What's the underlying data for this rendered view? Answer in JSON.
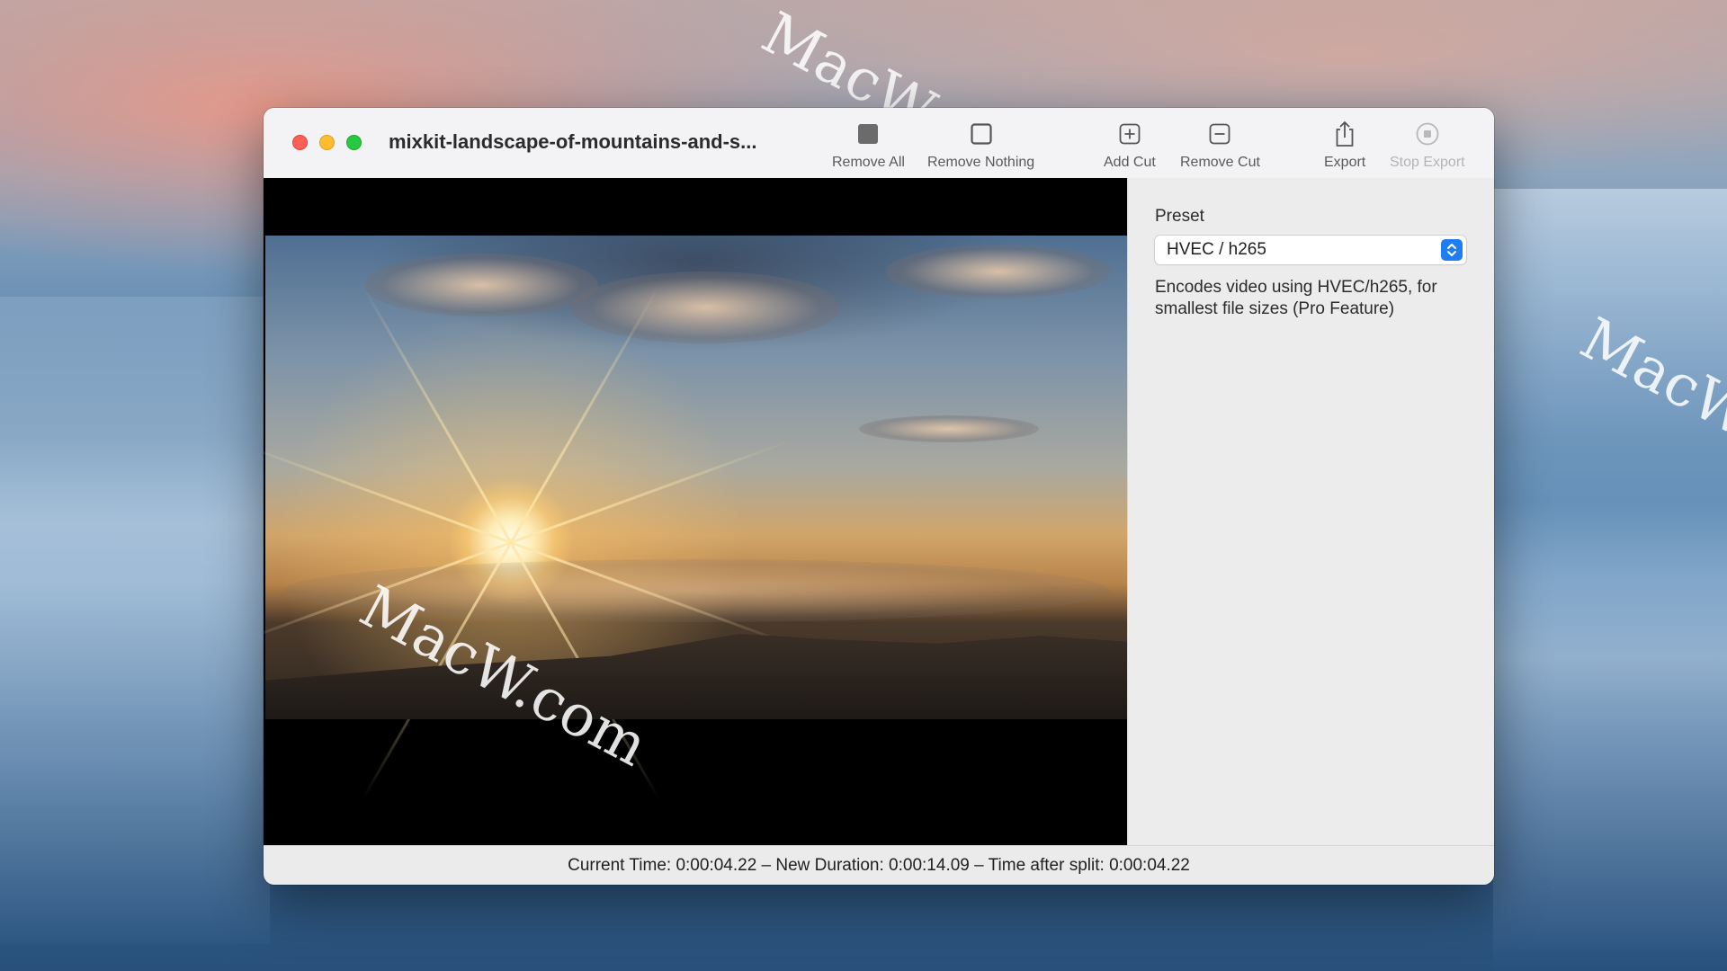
{
  "window": {
    "title": "mixkit-landscape-of-mountains-and-s..."
  },
  "toolbar": {
    "remove_all": "Remove All",
    "remove_nothing": "Remove Nothing",
    "add_cut": "Add Cut",
    "remove_cut": "Remove Cut",
    "export": "Export",
    "stop_export": "Stop Export"
  },
  "sidebar": {
    "preset_label": "Preset",
    "preset_value": "HVEC / h265",
    "preset_description": "Encodes video using HVEC/h265, for smallest file sizes (Pro Feature)"
  },
  "status": {
    "text": "Current Time: 0:00:04.22 – New Duration: 0:00:14.09 – Time after split: 0:00:04.22"
  },
  "watermark": {
    "text": "MacW.com"
  },
  "icons": {
    "remove_all": "filled-square-icon",
    "remove_nothing": "empty-square-icon",
    "add_cut": "plus-square-icon",
    "remove_cut": "minus-square-icon",
    "export": "share-icon",
    "stop_export": "stop-circle-icon",
    "preset_select": "up-down-chevron-icon"
  },
  "colors": {
    "accent": "#1f7cf2",
    "cut_region": "#ff3a5c",
    "playhead": "#f7c93b",
    "close": "#fe5f57",
    "minimize": "#febc2e",
    "zoom": "#28c840"
  }
}
